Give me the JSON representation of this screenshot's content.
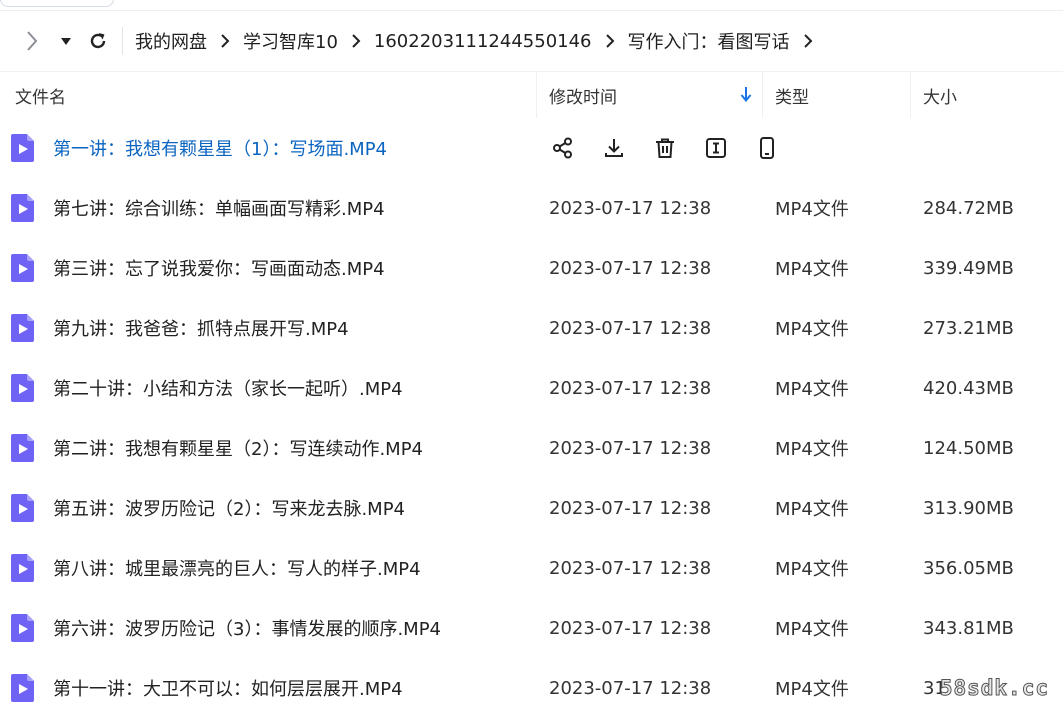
{
  "nav": {
    "breadcrumbs": [
      "我的网盘",
      "学习智库10",
      "1602203111244550146",
      "写作入门：看图写话"
    ]
  },
  "columns": {
    "name": "文件名",
    "time": "修改时间",
    "type": "类型",
    "size": "大小"
  },
  "sort": {
    "column": "修改时间",
    "direction": "descending"
  },
  "files": [
    {
      "name": "第一讲：我想有颗星星（1）：写场面.MP4",
      "time": "",
      "type": "",
      "size": "",
      "hovered": true
    },
    {
      "name": "第七讲：综合训练：单幅画面写精彩.MP4",
      "time": "2023-07-17 12:38",
      "type": "MP4文件",
      "size": "284.72MB"
    },
    {
      "name": "第三讲：忘了说我爱你：写画面动态.MP4",
      "time": "2023-07-17 12:38",
      "type": "MP4文件",
      "size": "339.49MB"
    },
    {
      "name": "第九讲：我爸爸：抓特点展开写.MP4",
      "time": "2023-07-17 12:38",
      "type": "MP4文件",
      "size": "273.21MB"
    },
    {
      "name": "第二十讲：小结和方法（家长一起听）.MP4",
      "time": "2023-07-17 12:38",
      "type": "MP4文件",
      "size": "420.43MB"
    },
    {
      "name": "第二讲：我想有颗星星（2）：写连续动作.MP4",
      "time": "2023-07-17 12:38",
      "type": "MP4文件",
      "size": "124.50MB"
    },
    {
      "name": "第五讲：波罗历险记（2）：写来龙去脉.MP4",
      "time": "2023-07-17 12:38",
      "type": "MP4文件",
      "size": "313.90MB"
    },
    {
      "name": "第八讲：城里最漂亮的巨人：写人的样子.MP4",
      "time": "2023-07-17 12:38",
      "type": "MP4文件",
      "size": "356.05MB"
    },
    {
      "name": "第六讲：波罗历险记（3）：事情发展的顺序.MP4",
      "time": "2023-07-17 12:38",
      "type": "MP4文件",
      "size": "343.81MB"
    },
    {
      "name": "第十一讲：大卫不可以：如何层层展开.MP4",
      "time": "2023-07-17 12:38",
      "type": "MP4文件",
      "size": "31"
    }
  ],
  "row_actions": [
    "share-icon",
    "download-icon",
    "delete-icon",
    "rename-icon",
    "phone-icon"
  ],
  "icons": {
    "file": "video-file-icon",
    "accent": "#6f63f6",
    "link_color": "#0b64c0"
  },
  "watermark": "58sdk.cc"
}
